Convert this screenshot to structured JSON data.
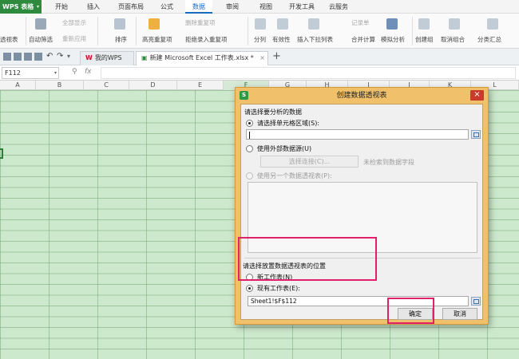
{
  "app": {
    "logo": "WPS 表格"
  },
  "menu": {
    "tabs": [
      "开始",
      "插入",
      "页面布局",
      "公式",
      "数据",
      "审阅",
      "视图",
      "开发工具",
      "云服务"
    ],
    "active": "数据"
  },
  "ribbon": {
    "pivot": "透视表",
    "auto_filter": "自动筛选",
    "show_all": "全部显示",
    "reapply": "重新应用",
    "sort": "排序",
    "highlight_dup": "高亮重复项",
    "delete_dup": "删除重复项",
    "reject_dup": "拒绝录入重复项",
    "split": "分列",
    "validity": "有效性",
    "dropdown": "插入下拉列表",
    "record": "记录单",
    "merge_calc": "合并计算",
    "simulate": "模拟分析",
    "create_group": "创建组",
    "ungroup": "取消组合",
    "subtotal": "分类汇总"
  },
  "doc_tabs": {
    "home": "我的WPS",
    "active": "新建 Microsoft Excel 工作表.xlsx *",
    "new_tab": "+"
  },
  "formula_bar": {
    "name_box": "F112",
    "fx": "fx"
  },
  "columns": [
    "A",
    "B",
    "C",
    "D",
    "E",
    "F",
    "G",
    "H",
    "I",
    "J",
    "K",
    "L"
  ],
  "dialog": {
    "title": "创建数据透视表",
    "close": "×",
    "app_icon": "S",
    "section1": "请选择要分析的数据",
    "opt_range": "请选择单元格区域(S):",
    "range_value": "",
    "opt_external": "使用外部数据源(U)",
    "choose_conn": "选择连接(C)...",
    "no_fields": "未检索到数据字段",
    "opt_other_pivot": "使用另一个数据透视表(P):",
    "section2": "请选择放置数据透视表的位置",
    "opt_new_sheet": "新工作表(N)",
    "opt_existing_sheet": "现有工作表(E):",
    "location_value": "Sheet1!$F$112",
    "ok": "确定",
    "cancel": "取消"
  },
  "colors": {
    "wps_green": "#2e8b3e",
    "accent_blue": "#1b6ac0",
    "dialog_frame": "#f0c16a",
    "sheet_fill": "#cde9cd",
    "highlight": "#e0206a"
  }
}
